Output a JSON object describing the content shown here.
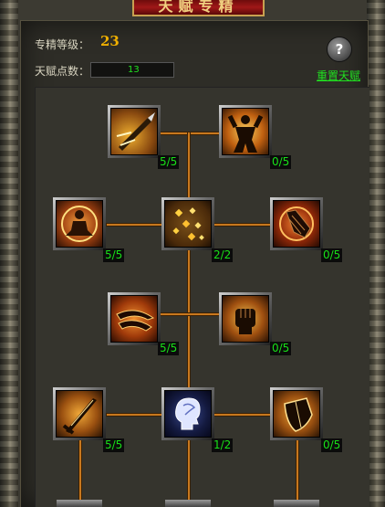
{
  "window": {
    "title": "天赋专精"
  },
  "header": {
    "level_label": "专精等级：",
    "level_value": "23",
    "points_label": "天赋点数：",
    "points_value": "13",
    "help_label": "?",
    "reset_label": "重置天赋"
  },
  "colors": {
    "connector": "#c8781e",
    "count_text": "#18e018",
    "accent_gold": "#f0b000"
  },
  "skills": [
    {
      "icon": "spear-strike-icon",
      "count": "5/5"
    },
    {
      "icon": "warrior-power-icon",
      "count": "0/5"
    },
    {
      "icon": "meditation-icon",
      "count": "5/5"
    },
    {
      "icon": "golden-dust-icon",
      "count": "2/2"
    },
    {
      "icon": "gauntlet-icon",
      "count": "0/5"
    },
    {
      "icon": "claw-slash-icon",
      "count": "5/5"
    },
    {
      "icon": "fist-icon",
      "count": "0/5"
    },
    {
      "icon": "sword-icon",
      "count": "5/5"
    },
    {
      "icon": "mind-head-icon",
      "count": "1/2"
    },
    {
      "icon": "shield-icon",
      "count": "0/5"
    }
  ]
}
